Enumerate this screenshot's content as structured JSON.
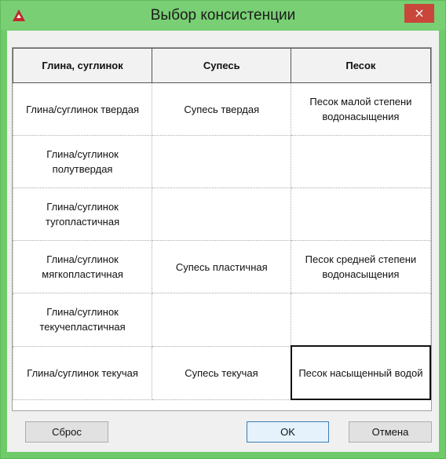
{
  "window": {
    "title": "Выбор консистенции",
    "close_label": "×"
  },
  "table": {
    "headers": [
      "Глина, суглинок",
      "Супесь",
      "Песок"
    ],
    "rows": [
      [
        "Глина/суглинок твердая",
        "Супесь твердая",
        "Песок малой степени водонасыщения"
      ],
      [
        "Глина/суглинок полутвердая",
        "",
        ""
      ],
      [
        "Глина/суглинок тугопластичная",
        "",
        ""
      ],
      [
        "Глина/суглинок мягкопластичная",
        "Супесь пластичная",
        "Песок средней степени водонасыщения"
      ],
      [
        "Глина/суглинок текучепластичная",
        "",
        ""
      ],
      [
        "Глина/суглинок текучая",
        "Супесь текучая",
        "Песок насыщенный водой"
      ]
    ],
    "selected_cell": "Песок насыщенный водой"
  },
  "buttons": {
    "reset": "Сброс",
    "ok": "OK",
    "cancel": "Отмена"
  },
  "colors": {
    "titlebar": "#79cf74",
    "close": "#c9463b",
    "app_icon": "#c0282d"
  },
  "icons": {
    "app": "autocad-logo-icon",
    "close": "close-icon"
  }
}
